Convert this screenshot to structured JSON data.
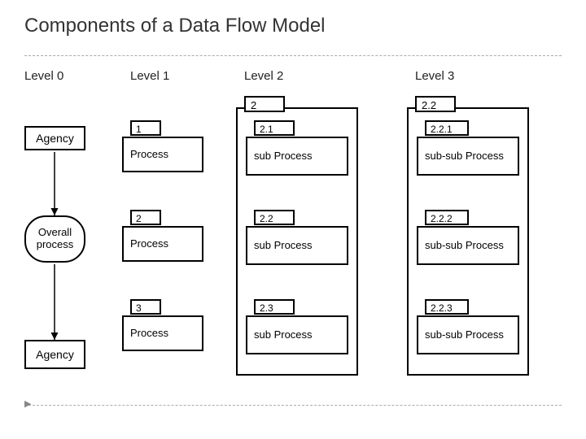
{
  "title": "Components of a Data Flow Model",
  "levels": [
    "Level 0",
    "Level 1",
    "Level 2",
    "Level 3"
  ],
  "level0": {
    "agency_top": "Agency",
    "overall_process": "Overall process",
    "agency_bottom": "Agency"
  },
  "level1": {
    "items": [
      {
        "id": "1",
        "label": "Process"
      },
      {
        "id": "2",
        "label": "Process"
      },
      {
        "id": "3",
        "label": "Process"
      }
    ]
  },
  "level2": {
    "header": "2",
    "items": [
      {
        "id": "2.1",
        "label": "sub Process"
      },
      {
        "id": "2.2",
        "label": "sub Process"
      },
      {
        "id": "2.3",
        "label": "sub Process"
      }
    ]
  },
  "level3": {
    "header": "2.2",
    "items": [
      {
        "id": "2.2.1",
        "label": "sub-sub Process"
      },
      {
        "id": "2.2.2",
        "label": "sub-sub Process"
      },
      {
        "id": "2.2.3",
        "label": "sub-sub Process"
      }
    ]
  }
}
